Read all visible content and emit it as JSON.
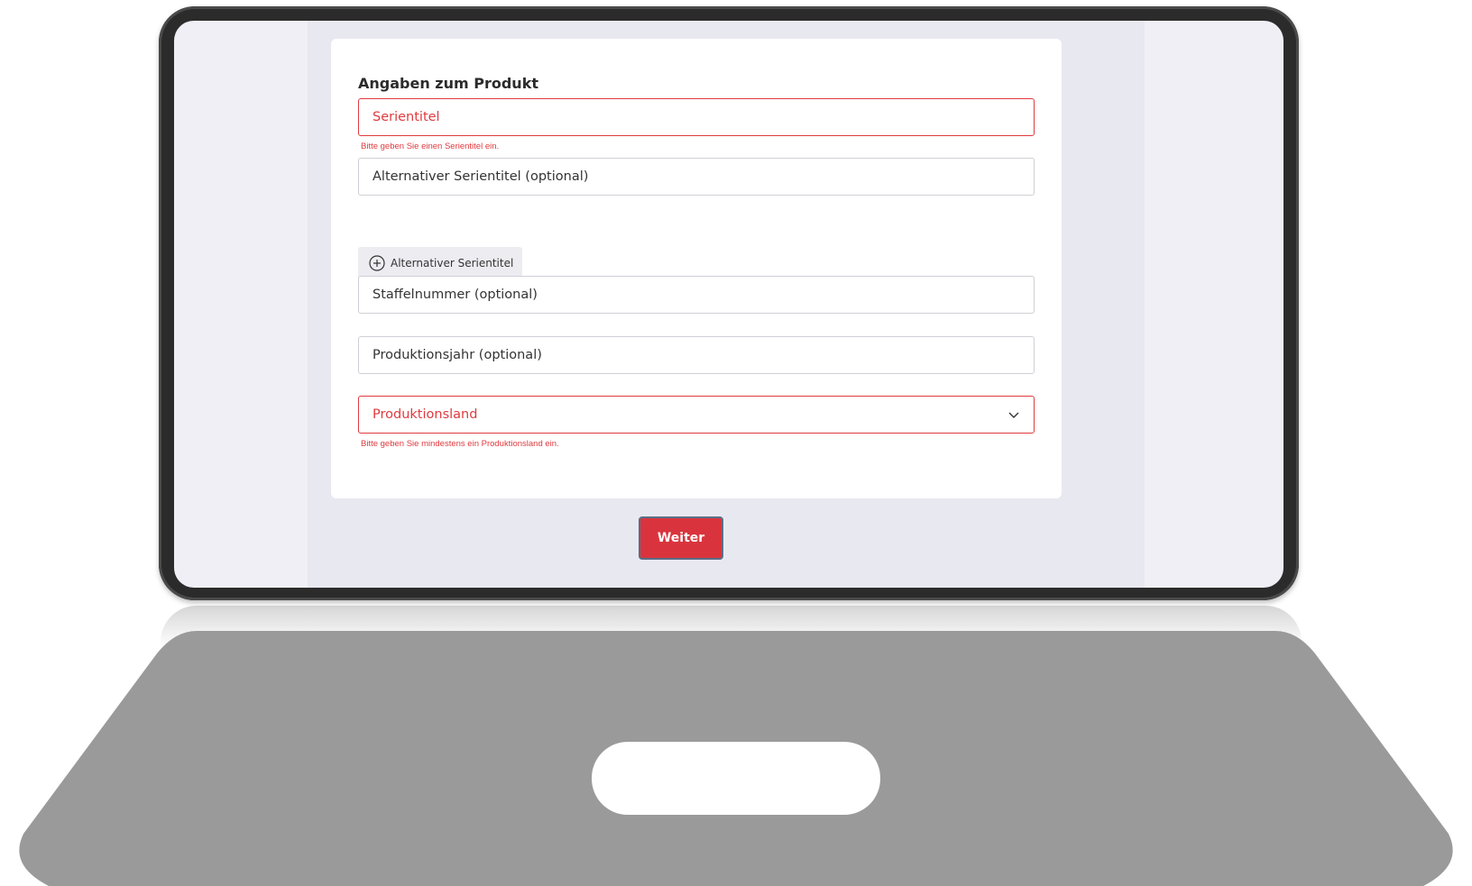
{
  "form": {
    "title": "Angaben zum Produkt",
    "serientitel": {
      "placeholder": "Serientitel",
      "error": "Bitte geben Sie einen Serientitel ein."
    },
    "alt_serientitel": {
      "placeholder": "Alternativer Serientitel (optional)"
    },
    "add_alt_button": {
      "label": "Alternativer Serientitel",
      "icon": "plus-circle-icon"
    },
    "staffelnummer": {
      "placeholder": "Staffelnummer (optional)"
    },
    "produktionsjahr": {
      "placeholder": "Produktionsjahr (optional)"
    },
    "produktionsland": {
      "placeholder": "Produktionsland",
      "icon": "chevron-down-icon",
      "error": "Bitte geben Sie mindestens ein Produktionsland ein."
    },
    "submit_label": "Weiter"
  },
  "colors": {
    "error": "#e03a3e",
    "primary_button": "#d9343d",
    "page_background": "#e8e8f0",
    "card": "#ffffff"
  }
}
